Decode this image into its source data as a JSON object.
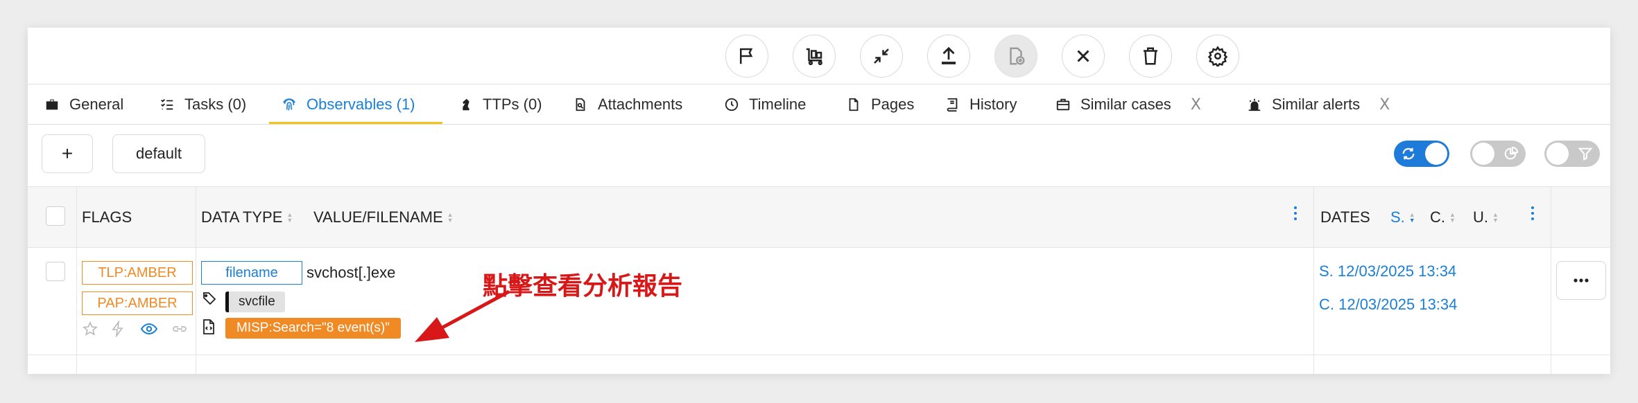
{
  "toolbar": {
    "buttons": [
      {
        "name": "flag"
      },
      {
        "name": "case-merge"
      },
      {
        "name": "minimize"
      },
      {
        "name": "export"
      },
      {
        "name": "add-file"
      },
      {
        "name": "close"
      },
      {
        "name": "delete"
      },
      {
        "name": "settings"
      }
    ]
  },
  "tabs": [
    {
      "label": "General",
      "icon": "briefcase-icon"
    },
    {
      "label": "Tasks (0)",
      "icon": "tasks-icon"
    },
    {
      "label": "Observables (1)",
      "icon": "fingerprint-icon",
      "active": true
    },
    {
      "label": "TTPs (0)",
      "icon": "chess-knight-icon"
    },
    {
      "label": "Attachments",
      "icon": "attachment-icon"
    },
    {
      "label": "Timeline",
      "icon": "clock-icon"
    },
    {
      "label": "Pages",
      "icon": "page-icon"
    },
    {
      "label": "History",
      "icon": "book-icon"
    },
    {
      "label": "Similar cases",
      "icon": "briefcase-outline-icon",
      "closable": true
    },
    {
      "label": "Similar alerts",
      "icon": "alert-icon",
      "closable": true
    }
  ],
  "tab_close_glyph": "X",
  "filters": {
    "add_label": "+",
    "preset_label": "default",
    "toggles": [
      {
        "name": "auto-refresh",
        "on": true
      },
      {
        "name": "stats",
        "on": false
      },
      {
        "name": "filters",
        "on": false
      }
    ]
  },
  "table": {
    "headers": {
      "flags": "FLAGS",
      "data_type": "DATA TYPE",
      "value": "VALUE/FILENAME",
      "dates": "DATES",
      "s": "S.",
      "c": "C.",
      "u": "U."
    },
    "rows": [
      {
        "tlp": "TLP:AMBER",
        "pap": "PAP:AMBER",
        "data_type": "filename",
        "value": "svchost[.]exe",
        "tag": "svcfile",
        "analyzer_report": "MISP:Search=\"8 event(s)\"",
        "date_s": "S. 12/03/2025 13:34",
        "date_c": "C. 12/03/2025 13:34"
      }
    ]
  },
  "annotation": {
    "text": "點擊查看分析報告",
    "color": "#d81818"
  },
  "colors": {
    "accent": "#1a7fd6",
    "amber": "#f08a24",
    "tab_underline": "#f0c419"
  }
}
